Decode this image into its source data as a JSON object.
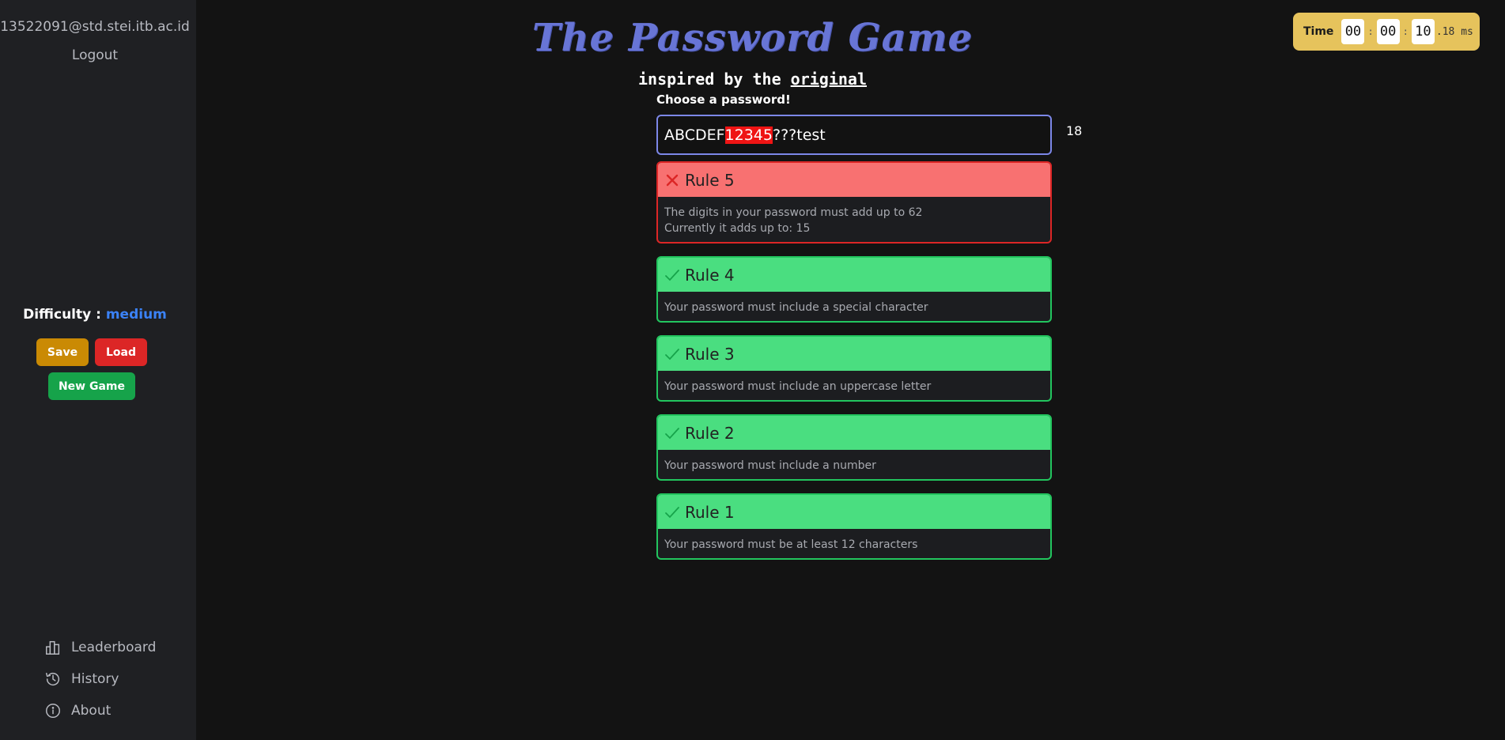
{
  "sidebar": {
    "user_email": "13522091@std.stei.itb.ac.id",
    "logout_label": "Logout",
    "difficulty_label": "Difficulty : ",
    "difficulty_value": "medium",
    "save_label": "Save",
    "load_label": "Load",
    "new_game_label": "New Game",
    "nav": {
      "leaderboard": {
        "label": "Leaderboard",
        "icon": "bar-chart-icon"
      },
      "history": {
        "label": "History",
        "icon": "history-icon"
      },
      "about": {
        "label": "About",
        "icon": "info-icon"
      }
    }
  },
  "timer": {
    "label": "Time",
    "hours": "00",
    "minutes": "00",
    "seconds": "10",
    "ms_value": "18",
    "ms_unit": "ms"
  },
  "header": {
    "title": "The Password Game",
    "subtitle_prefix": "inspired by the ",
    "subtitle_link": "original"
  },
  "password": {
    "label": "Choose a password!",
    "value_before": "ABCDEF",
    "value_highlight": "12345",
    "value_after": "???test",
    "length": "18"
  },
  "rules": {
    "r5": {
      "title": "Rule 5",
      "status": "fail",
      "text1": "The digits in your password must add up to 62",
      "text2": "Currently it adds up to: 15"
    },
    "r4": {
      "title": "Rule 4",
      "status": "pass",
      "text": "Your password must include a special character"
    },
    "r3": {
      "title": "Rule 3",
      "status": "pass",
      "text": "Your password must include an uppercase letter"
    },
    "r2": {
      "title": "Rule 2",
      "status": "pass",
      "text": "Your password must include a number"
    },
    "r1": {
      "title": "Rule 1",
      "status": "pass",
      "text": "Your password must be at least 12 characters"
    }
  },
  "colors": {
    "accent": "#6875d6",
    "pass": "#4ade80",
    "fail": "#f87171",
    "difficulty": "#3b82f6",
    "timer_bg": "#e6c35c"
  }
}
